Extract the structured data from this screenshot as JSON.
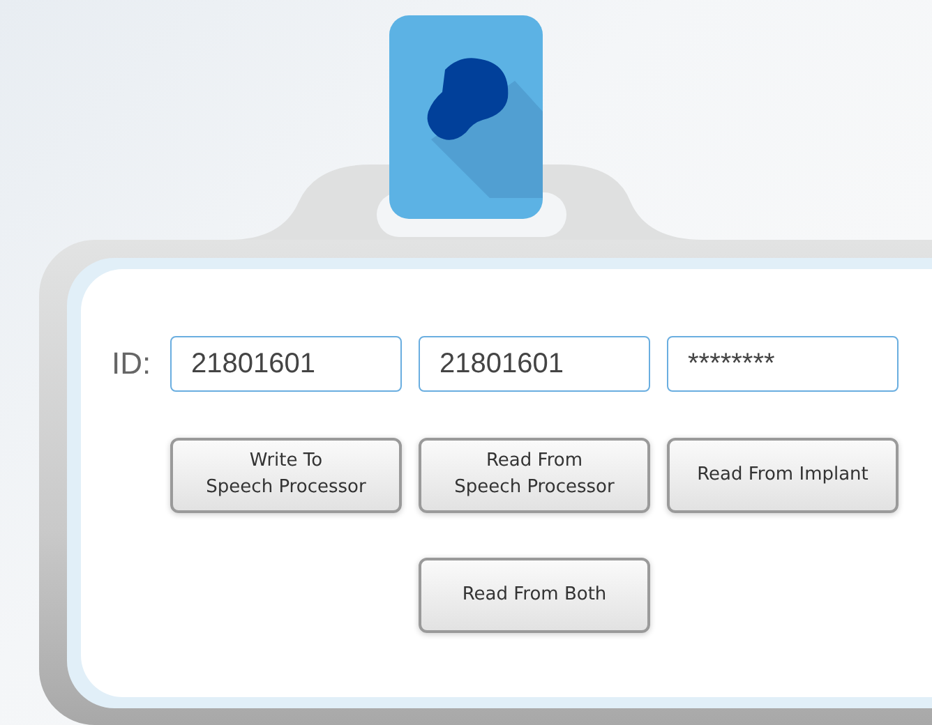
{
  "id_label": "ID:",
  "fields": [
    {
      "value": "21801601"
    },
    {
      "value": "21801601"
    },
    {
      "value": "********"
    }
  ],
  "buttons": [
    {
      "label": "Write To\nSpeech Processor"
    },
    {
      "label": "Read From\nSpeech Processor"
    },
    {
      "label": "Read From Implant"
    },
    {
      "label": "Read From Both"
    }
  ]
}
